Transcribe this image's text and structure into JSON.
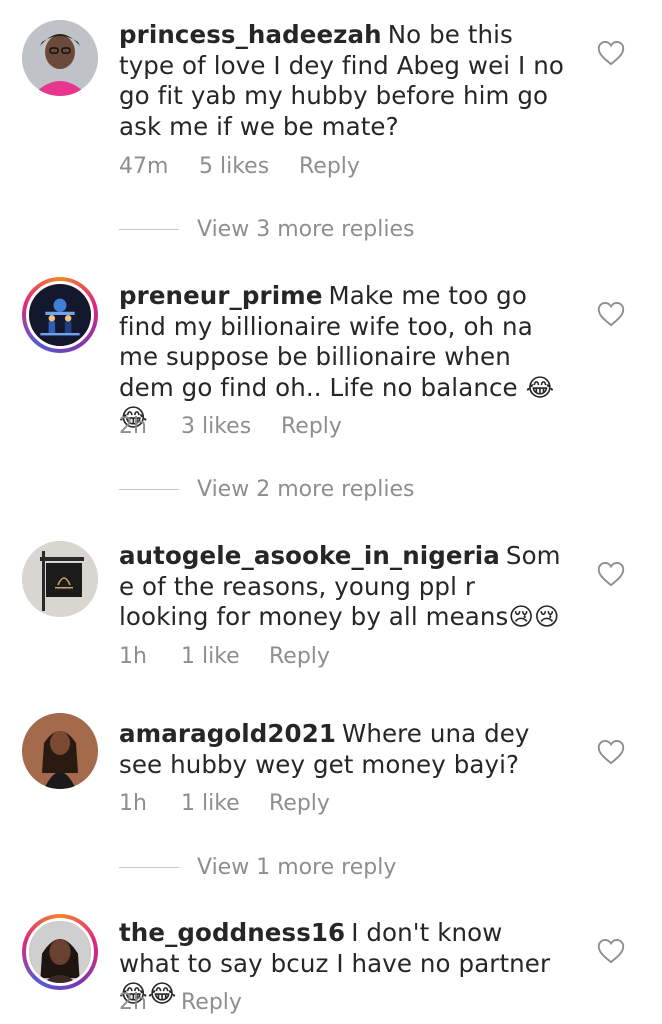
{
  "comments": [
    {
      "username": "princess_hadeezah",
      "text": "No be this type of love I dey find Abeg wei I no go fit yab my hubby before him go ask me if we be mate?",
      "time": "47m",
      "likes": "5 likes",
      "reply": "Reply",
      "view_replies": "View 3 more replies",
      "avatar_icon": "person-avatar-icon",
      "ring": false
    },
    {
      "username": "preneur_prime",
      "text": "Make me too go find my billionaire wife too, oh na me suppose be billionaire when dem go find oh.. Life no balance 😂😂",
      "time": "2h",
      "likes": "3 likes",
      "reply": "Reply",
      "view_replies": "View 2 more replies",
      "avatar_icon": "business-team-avatar-icon",
      "ring": true
    },
    {
      "username": "autogele_asooke_in_nigeria",
      "text": "Some of the reasons, young ppl r looking for money by all means😢😢",
      "time": "1h",
      "likes": "1 like",
      "reply": "Reply",
      "view_replies": "",
      "avatar_icon": "shop-sign-avatar-icon",
      "ring": false
    },
    {
      "username": "amaragold2021",
      "text": "Where una dey see hubby wey get money bayi?",
      "time": "1h",
      "likes": "1 like",
      "reply": "Reply",
      "view_replies": "View 1 more reply",
      "avatar_icon": "woman-avatar-icon",
      "ring": false
    },
    {
      "username": "the_goddness16",
      "text": "I don't know what to say bcuz I have no partner😂😂",
      "time": "2h",
      "likes": "",
      "reply": "Reply",
      "view_replies": "",
      "avatar_icon": "woman-portrait-avatar-icon",
      "ring": true
    }
  ],
  "colors": {
    "text": "#262626",
    "muted": "#8e8e8e",
    "divider": "#c7c7c7"
  }
}
